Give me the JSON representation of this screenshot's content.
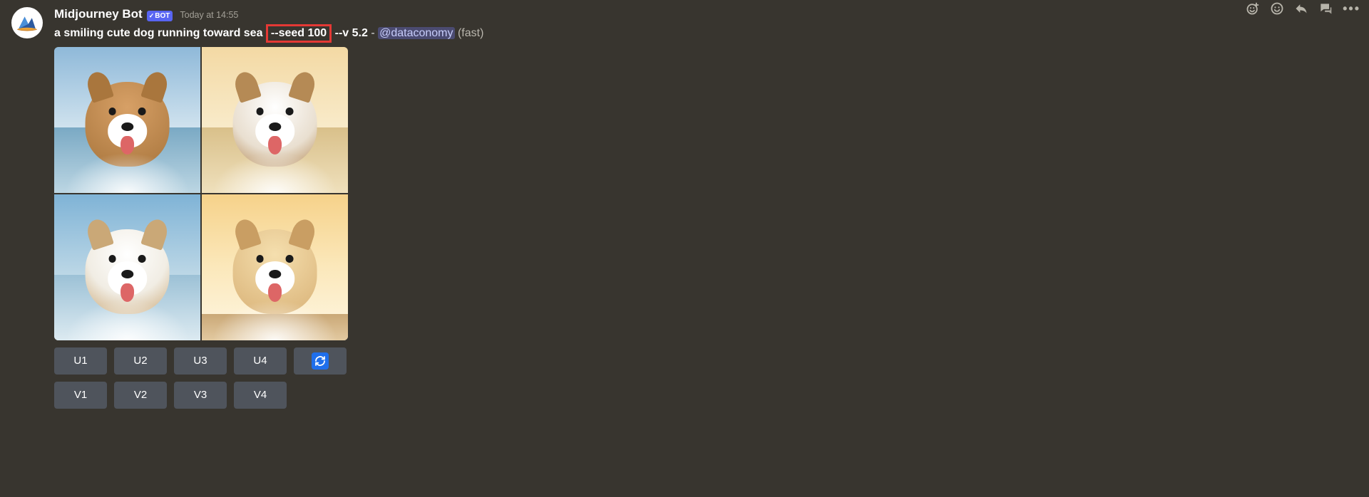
{
  "author": {
    "name": "Midjourney Bot",
    "bot_tag": "BOT",
    "timestamp": "Today at 14:55"
  },
  "prompt": {
    "text_prefix": "a smiling cute dog running toward sea ",
    "seed_fragment": "--seed 100",
    "text_suffix": " --v 5.2",
    "dash": " - ",
    "mention": "@dataconomy",
    "mode": " (fast)"
  },
  "buttons": {
    "u": [
      "U1",
      "U2",
      "U3",
      "U4"
    ],
    "v": [
      "V1",
      "V2",
      "V3",
      "V4"
    ],
    "reroll_icon": "reroll"
  },
  "hover_actions": [
    "add-reaction",
    "super-reaction",
    "reply",
    "create-thread",
    "more"
  ]
}
